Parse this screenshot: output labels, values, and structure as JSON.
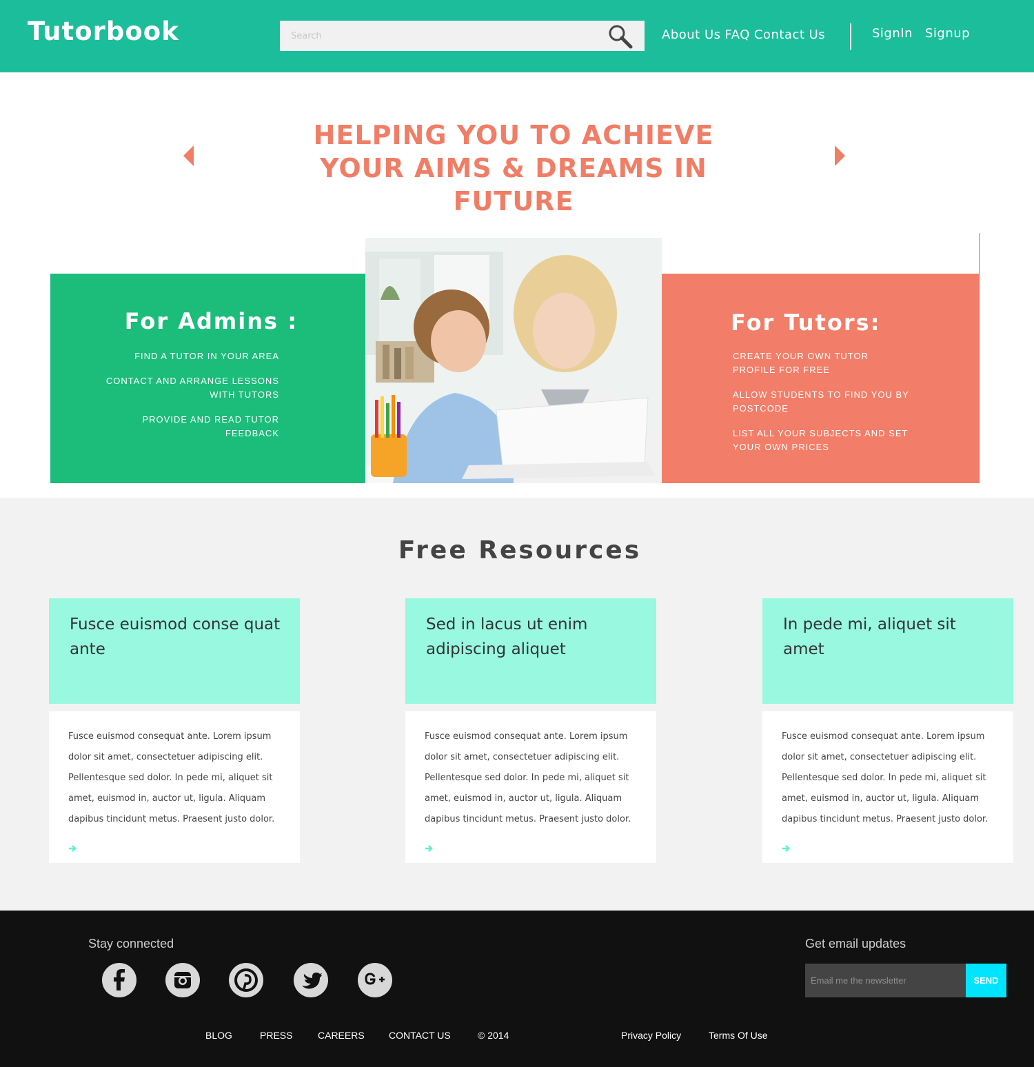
{
  "header": {
    "logo": "Tutorbook",
    "search_placeholder": "Search",
    "nav": [
      "About Us",
      "FAQ",
      "Contact Us"
    ],
    "auth": [
      "SignIn",
      "Signup"
    ]
  },
  "hero": {
    "title": "HELPING YOU TO ACHIEVE YOUR AIMS & DREAMS IN FUTURE"
  },
  "admins": {
    "title": "For Admins :",
    "items": [
      "FIND A TUTOR IN YOUR AREA",
      "CONTACT AND ARRANGE LESSONS WITH TUTORS",
      "PROVIDE AND READ TUTOR FEEDBACK"
    ]
  },
  "tutors": {
    "title": "For Tutors:",
    "items": [
      "CREATE YOUR OWN TUTOR PROFILE FOR FREE",
      "ALLOW STUDENTS TO FIND YOU BY POSTCODE",
      "LIST ALL YOUR SUBJECTS AND SET YOUR OWN PRICES"
    ]
  },
  "resources": {
    "title": "Free Resources",
    "cards": [
      {
        "title": "Fusce euismod conse quat ante",
        "body": "Fusce euismod consequat ante. Lorem ipsum dolor sit amet, consectetuer adipiscing elit. Pellentesque sed dolor. In pede mi, aliquet sit amet, euismod in, auctor ut, ligula. Aliquam dapibus tincidunt metus. Praesent justo dolor."
      },
      {
        "title": "Sed in lacus ut enim adipiscing aliquet",
        "body": "Fusce euismod consequat ante. Lorem ipsum dolor sit amet, consectetuer adipiscing elit. Pellentesque sed dolor. In pede mi, aliquet sit amet, euismod in, auctor ut, ligula. Aliquam dapibus tincidunt metus. Praesent justo dolor."
      },
      {
        "title": "In pede mi, aliquet sit amet",
        "body": "Fusce euismod consequat ante. Lorem ipsum dolor sit amet, consectetuer adipiscing elit. Pellentesque sed dolor. In pede mi, aliquet sit amet, euismod in, auctor ut, ligula. Aliquam dapibus tincidunt metus. Praesent justo dolor."
      }
    ]
  },
  "footer": {
    "stay_connected": "Stay connected",
    "social_icons": [
      "facebook-icon",
      "instagram-icon",
      "pinterest-icon",
      "twitter-icon",
      "google-plus-icon"
    ],
    "email_title": "Get email updates",
    "email_placeholder": "Email me the newsletter",
    "send_label": "SEND",
    "links": [
      "BLOG",
      "PRESS",
      "CAREERS",
      "CONTACT US"
    ],
    "copyright": "© 2014",
    "legal": [
      "Privacy Policy",
      "Terms Of Use"
    ]
  },
  "colors": {
    "header": "#1cbd9b",
    "accent_coral": "#f07e66",
    "admins_panel": "#1cbc7b",
    "tutors_panel": "#f27d68",
    "card_head": "#98f8e0",
    "send_button": "#00e4ff"
  }
}
